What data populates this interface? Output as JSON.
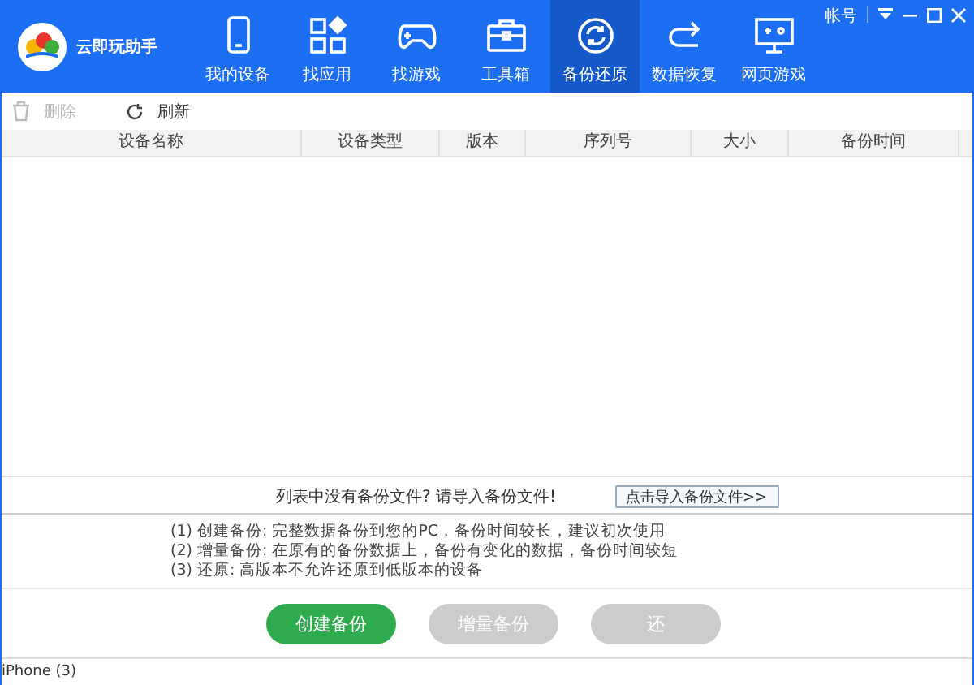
{
  "app": {
    "title": "云即玩助手"
  },
  "window_controls": {
    "account": "帐号"
  },
  "nav": [
    {
      "label": "我的设备",
      "kind": "phone",
      "selected": false
    },
    {
      "label": "找应用",
      "kind": "apps",
      "selected": false
    },
    {
      "label": "找游戏",
      "kind": "gamepad",
      "selected": false
    },
    {
      "label": "工具箱",
      "kind": "toolbox",
      "selected": false
    },
    {
      "label": "备份还原",
      "kind": "sync",
      "selected": true
    },
    {
      "label": "数据恢复",
      "kind": "redo",
      "selected": false
    },
    {
      "label": "网页游戏",
      "kind": "monitor",
      "selected": false
    }
  ],
  "toolbar": [
    {
      "label": "删除",
      "kind": "trash",
      "disabled": true
    },
    {
      "label": "刷新",
      "kind": "refresh",
      "disabled": false
    }
  ],
  "table": {
    "columns": [
      "设备名称",
      "设备类型",
      "版本",
      "序列号",
      "大小",
      "备份时间"
    ]
  },
  "empty": {
    "message": "列表中没有备份文件? 请导入备份文件!",
    "button": "点击导入备份文件>>"
  },
  "notes": [
    "(1) 创建备份: 完整数据备份到您的PC，备份时间较长，建议初次使用",
    "(2) 增量备份: 在原有的备份数据上，备份有变化的数据，备份时间较短",
    "(3) 还原: 高版本不允许还原到低版本的设备"
  ],
  "actions": [
    {
      "label": "创建备份",
      "disabled": false
    },
    {
      "label": "增量备份",
      "disabled": true
    },
    {
      "label": "还",
      "disabled": true
    }
  ],
  "status_bar": {
    "text": "iPhone (3)"
  }
}
